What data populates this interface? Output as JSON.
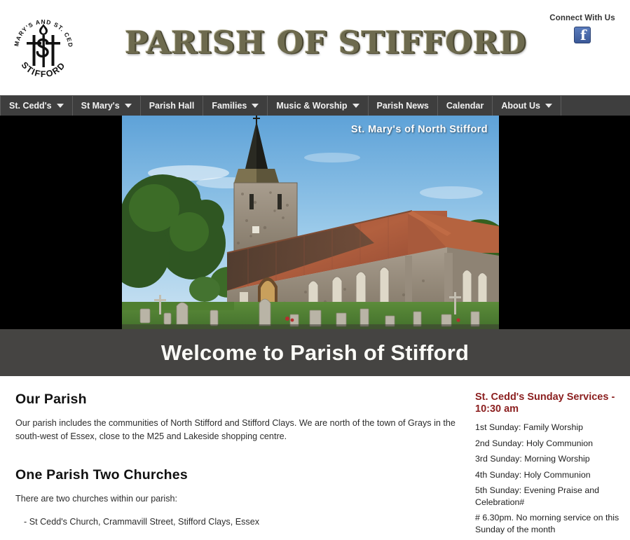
{
  "header": {
    "logo_text_top": "ST. MARY'S AND ST. CEDD'S",
    "logo_text_bottom": "STIFFORD",
    "site_title": "PARISH OF STIFFORD",
    "connect_label": "Connect With Us",
    "facebook_icon": "facebook-icon"
  },
  "nav": {
    "items": [
      {
        "label": "St. Cedd's",
        "has_dropdown": true
      },
      {
        "label": "St Mary's",
        "has_dropdown": true
      },
      {
        "label": "Parish Hall",
        "has_dropdown": false
      },
      {
        "label": "Families",
        "has_dropdown": true
      },
      {
        "label": "Music & Worship",
        "has_dropdown": true
      },
      {
        "label": "Parish News",
        "has_dropdown": false
      },
      {
        "label": "Calendar",
        "has_dropdown": false
      },
      {
        "label": "About Us",
        "has_dropdown": true
      }
    ]
  },
  "hero": {
    "caption": "St. Mary's of North Stifford",
    "image_alt": "st-marys-church-photo"
  },
  "welcome": {
    "title": "Welcome to Parish of Stifford"
  },
  "main": {
    "section1_heading": "Our Parish",
    "section1_text": "Our parish includes the communities of North Stifford and Stifford Clays. We are north of the town of Grays in the south-west of Essex, close to the M25 and Lakeside shopping centre.",
    "section2_heading": "One Parish Two Churches",
    "section2_text": "There are two churches within our parish:",
    "church_1": "- St Cedd's Church, Crammavill Street, Stifford Clays, Essex"
  },
  "sidebar": {
    "title": "St. Cedd's Sunday Services - 10:30 am",
    "services": [
      "1st Sunday: Family Worship",
      "2nd Sunday: Holy Communion",
      "3rd Sunday: Morning Worship",
      "4th Sunday: Holy Communion",
      "5th Sunday: Evening Praise and Celebration#"
    ],
    "note": "# 6.30pm. No morning service on this Sunday of the month"
  },
  "colors": {
    "nav_bg": "#3e3e3e",
    "welcome_bg": "#454442",
    "hero_bg": "#000000",
    "title_gold": "#6d6a4e",
    "sidebar_heading": "#8b1f1f",
    "facebook_blue": "#3b5998"
  }
}
